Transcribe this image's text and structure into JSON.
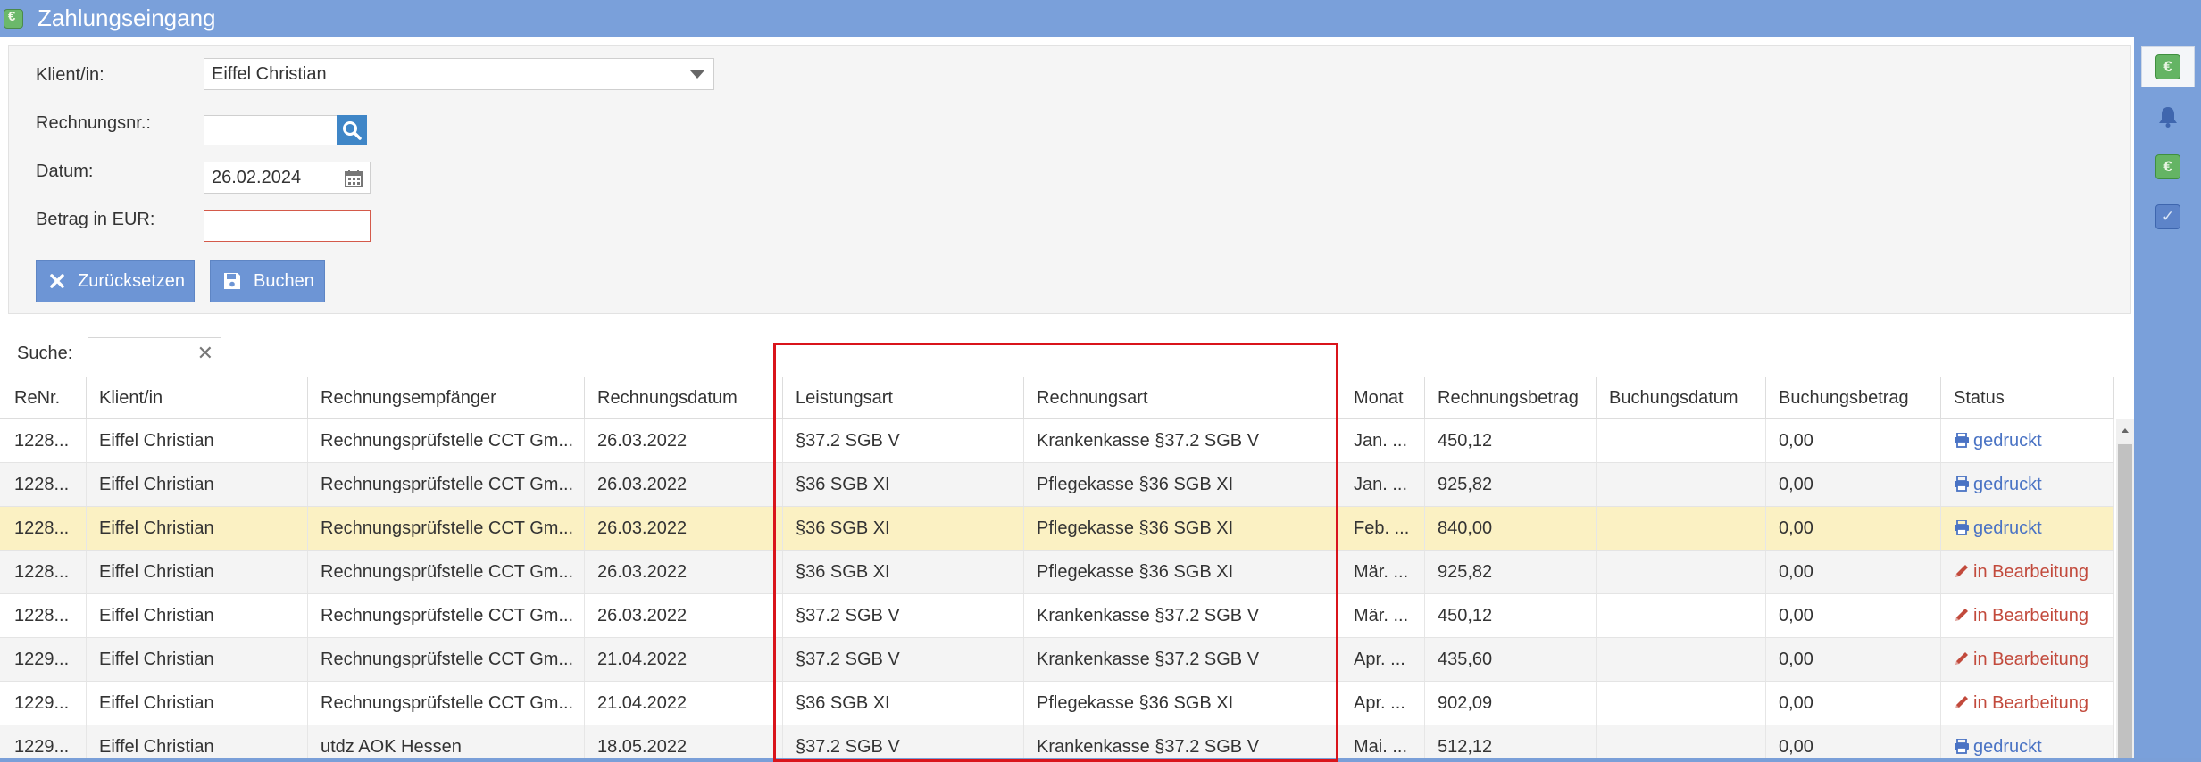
{
  "window": {
    "title": "Zahlungseingang"
  },
  "form": {
    "klient_label": "Klient/in:",
    "klient_value": "Eiffel Christian",
    "rechnungsnr_label": "Rechnungsnr.:",
    "rechnungsnr_value": "",
    "datum_label": "Datum:",
    "datum_value": "26.02.2024",
    "betrag_label": "Betrag in EUR:",
    "betrag_value": "",
    "reset_label": "Zurücksetzen",
    "book_label": "Buchen"
  },
  "search": {
    "label": "Suche:",
    "value": ""
  },
  "table": {
    "columns": [
      "ReNr.",
      "Klient/in",
      "Rechnungsempfänger",
      "Rechnungsdatum",
      "Leistungsart",
      "Rechnungsart",
      "Monat",
      "Rechnungsbetrag",
      "Buchungsdatum",
      "Buchungsbetrag",
      "Status"
    ],
    "rows": [
      {
        "renr": "1228...",
        "klient": "Eiffel Christian",
        "empfaenger": "Rechnungsprüfstelle CCT Gm...",
        "datum": "26.03.2022",
        "leistungsart": "§37.2 SGB V",
        "rechnungsart": "Krankenkasse §37.2 SGB V",
        "monat": "Jan. ...",
        "betrag": "450,12",
        "buchungsdatum": "",
        "buchungsbetrag": "0,00",
        "status": "gedruckt",
        "status_type": "printed"
      },
      {
        "renr": "1228...",
        "klient": "Eiffel Christian",
        "empfaenger": "Rechnungsprüfstelle CCT Gm...",
        "datum": "26.03.2022",
        "leistungsart": "§36 SGB XI",
        "rechnungsart": "Pflegekasse §36 SGB XI",
        "monat": "Jan. ...",
        "betrag": "925,82",
        "buchungsdatum": "",
        "buchungsbetrag": "0,00",
        "status": "gedruckt",
        "status_type": "printed"
      },
      {
        "renr": "1228...",
        "klient": "Eiffel Christian",
        "empfaenger": "Rechnungsprüfstelle CCT Gm...",
        "datum": "26.03.2022",
        "leistungsart": "§36 SGB XI",
        "rechnungsart": "Pflegekasse §36 SGB XI",
        "monat": "Feb. ...",
        "betrag": "840,00",
        "buchungsdatum": "",
        "buchungsbetrag": "0,00",
        "status": "gedruckt",
        "status_type": "printed"
      },
      {
        "renr": "1228...",
        "klient": "Eiffel Christian",
        "empfaenger": "Rechnungsprüfstelle CCT Gm...",
        "datum": "26.03.2022",
        "leistungsart": "§36 SGB XI",
        "rechnungsart": "Pflegekasse §36 SGB XI",
        "monat": "Mär. ...",
        "betrag": "925,82",
        "buchungsdatum": "",
        "buchungsbetrag": "0,00",
        "status": "in Bearbeitung",
        "status_type": "edit"
      },
      {
        "renr": "1228...",
        "klient": "Eiffel Christian",
        "empfaenger": "Rechnungsprüfstelle CCT Gm...",
        "datum": "26.03.2022",
        "leistungsart": "§37.2 SGB V",
        "rechnungsart": "Krankenkasse §37.2 SGB V",
        "monat": "Mär. ...",
        "betrag": "450,12",
        "buchungsdatum": "",
        "buchungsbetrag": "0,00",
        "status": "in Bearbeitung",
        "status_type": "edit"
      },
      {
        "renr": "1229...",
        "klient": "Eiffel Christian",
        "empfaenger": "Rechnungsprüfstelle CCT Gm...",
        "datum": "21.04.2022",
        "leistungsart": "§37.2 SGB V",
        "rechnungsart": "Krankenkasse §37.2 SGB V",
        "monat": "Apr. ...",
        "betrag": "435,60",
        "buchungsdatum": "",
        "buchungsbetrag": "0,00",
        "status": "in Bearbeitung",
        "status_type": "edit"
      },
      {
        "renr": "1229...",
        "klient": "Eiffel Christian",
        "empfaenger": "Rechnungsprüfstelle CCT Gm...",
        "datum": "21.04.2022",
        "leistungsart": "§36 SGB XI",
        "rechnungsart": "Pflegekasse §36 SGB XI",
        "monat": "Apr. ...",
        "betrag": "902,09",
        "buchungsdatum": "",
        "buchungsbetrag": "0,00",
        "status": "in Bearbeitung",
        "status_type": "edit"
      },
      {
        "renr": "1229...",
        "klient": "Eiffel Christian",
        "empfaenger": "utdz AOK Hessen",
        "datum": "18.05.2022",
        "leistungsart": "§37.2 SGB V",
        "rechnungsart": "Krankenkasse §37.2 SGB V",
        "monat": "Mai. ...",
        "betrag": "512,12",
        "buchungsdatum": "",
        "buchungsbetrag": "0,00",
        "status": "gedruckt",
        "status_type": "printed"
      }
    ],
    "selected_row": 2
  },
  "sidebar": {
    "items": [
      {
        "icon": "payment-icon",
        "glyph": "€",
        "style": "green",
        "active": true
      },
      {
        "icon": "bell-icon",
        "glyph": "",
        "style": "blue",
        "active": false
      },
      {
        "icon": "invoice-icon",
        "glyph": "€",
        "style": "green",
        "active": false
      },
      {
        "icon": "check-icon",
        "glyph": "✓",
        "style": "blue",
        "active": false
      }
    ]
  },
  "colors": {
    "accent": "#6d95d5",
    "printed": "#4a73c4",
    "edit": "#c24a3c",
    "highlight": "#d9141b",
    "selected_row": "#fbf1c3"
  }
}
